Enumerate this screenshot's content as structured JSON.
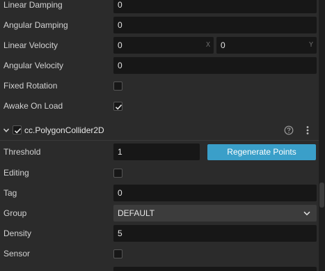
{
  "rigidbody": {
    "linear_damping": {
      "label": "Linear Damping",
      "value": "0"
    },
    "angular_damping": {
      "label": "Angular Damping",
      "value": "0"
    },
    "linear_velocity": {
      "label": "Linear Velocity",
      "x": "0",
      "y": "0",
      "x_axis": "X",
      "y_axis": "Y"
    },
    "angular_velocity": {
      "label": "Angular Velocity",
      "value": "0"
    },
    "fixed_rotation": {
      "label": "Fixed Rotation",
      "checked": false
    },
    "awake_on_load": {
      "label": "Awake On Load",
      "checked": true
    }
  },
  "collider": {
    "title": "cc.PolygonCollider2D",
    "enabled": true,
    "help_icon": "question-circle-icon",
    "more_icon": "vertical-ellipsis-icon",
    "threshold": {
      "label": "Threshold",
      "value": "1"
    },
    "regenerate_label": "Regenerate Points",
    "editing": {
      "label": "Editing",
      "checked": false
    },
    "tag": {
      "label": "Tag",
      "value": "0"
    },
    "group": {
      "label": "Group",
      "value": "DEFAULT"
    },
    "density": {
      "label": "Density",
      "value": "5"
    },
    "sensor": {
      "label": "Sensor",
      "checked": false
    }
  },
  "colors": {
    "background": "#2b2b2b",
    "field": "#171717",
    "accent_button": "#3a9fc9"
  }
}
